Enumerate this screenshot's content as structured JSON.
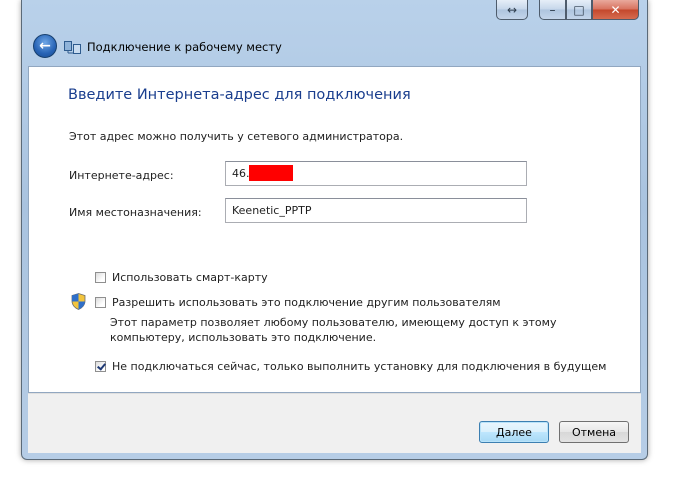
{
  "window": {
    "title": "Подключение к рабочему месту",
    "caption_buttons": {
      "arrows_icon": "↔",
      "minimize_icon": "–",
      "maximize_icon": "□",
      "close_icon": "✕"
    },
    "back_icon": "←"
  },
  "page": {
    "heading": "Введите Интернета-адрес для подключения",
    "description": "Этот адрес можно получить у сетевого администратора."
  },
  "fields": {
    "internet_address": {
      "label": "Интернете-адрес:",
      "value": "46."
    },
    "destination_name": {
      "label": "Имя местоназначения:",
      "value": "Keenetic_PPTP"
    }
  },
  "options": {
    "smart_card": {
      "label": "Использовать смарт-карту",
      "checked": false
    },
    "allow_others": {
      "label": "Разрешить использовать это подключение другим пользователям",
      "description_line1": "Этот параметр позволяет любому пользователю, имеющему доступ к этому",
      "description_line2": "компьютеру, использовать это подключение.",
      "checked": false
    },
    "dont_connect_now": {
      "label": "Не подключаться сейчас, только выполнить установку для подключения в будущем",
      "checked": true
    }
  },
  "buttons": {
    "next": "Далее",
    "cancel": "Отмена"
  },
  "colors": {
    "heading": "#1a3e8e",
    "redaction": "#ff0000",
    "close_button": "#c4482c"
  }
}
